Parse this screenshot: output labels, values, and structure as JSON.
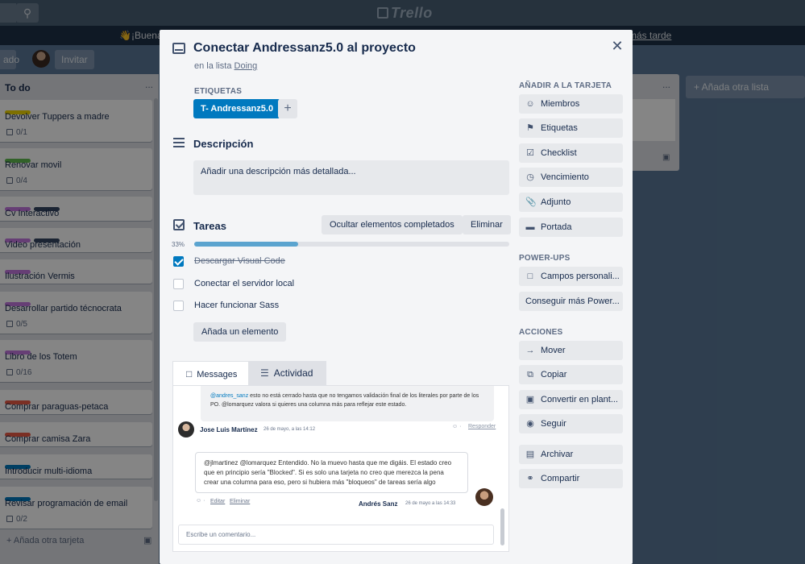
{
  "app": {
    "logo_text": "Trello"
  },
  "banner": {
    "greeting": "👋¡Buenas",
    "later_link": "más tarde"
  },
  "boardbar": {
    "left_btn": "ado",
    "invite_label": "Invitar"
  },
  "todo_list": {
    "title": "To do",
    "more": "...",
    "add_card": "+ Añada otra tarjeta",
    "cards": [
      {
        "title": "Devolver Tuppers a madre",
        "badge": "0/1",
        "labels": [
          "#f2d600"
        ]
      },
      {
        "title": "Renovar movil",
        "badge": "0/4",
        "labels": [
          "#61bd4f"
        ]
      },
      {
        "title": "Cv Interactivo",
        "badge": "",
        "labels": [
          "#c377e0",
          "#344563"
        ]
      },
      {
        "title": "Video presentación",
        "badge": "",
        "labels": [
          "#c377e0",
          "#344563"
        ]
      },
      {
        "title": "Ilustración Vermis",
        "badge": "",
        "labels": [
          "#c377e0"
        ]
      },
      {
        "title": "Desarrollar partido técnocrata",
        "badge": "0/5",
        "labels": [
          "#c377e0"
        ]
      },
      {
        "title": "Libro de los Totem",
        "badge": "0/16",
        "labels": [
          "#c377e0"
        ]
      },
      {
        "title": "Comprar paraguas-petaca",
        "badge": "",
        "labels": [
          "#eb5a46"
        ]
      },
      {
        "title": "Comprar camisa Zara",
        "badge": "",
        "labels": [
          "#eb5a46"
        ]
      },
      {
        "title": "Introducir multi-idioma",
        "badge": "",
        "labels": [
          "#0079bf"
        ]
      },
      {
        "title": "Revisar programación de email",
        "badge": "0/2",
        "labels": [
          "#0079bf"
        ]
      }
    ]
  },
  "doing_list": {
    "more": "..."
  },
  "add_list": "+ Añada otra lista",
  "modal": {
    "title": "Conectar Andressanz5.0 al proyecto",
    "in_list_prefix": "en la lista ",
    "in_list_name": "Doing",
    "labels_heading": "ETIQUETAS",
    "label_chip": "T- Andressanz5.0",
    "label_chip_color": "#0079bf",
    "description_heading": "Descripción",
    "description_placeholder": "Añadir una descripción más detallada...",
    "checklist": {
      "title": "Tareas",
      "hide_label": "Ocultar elementos completados",
      "delete_label": "Eliminar",
      "progress_text": "33%",
      "progress": 0.33,
      "items": [
        {
          "text": "Descargar Visual Code",
          "done": true
        },
        {
          "text": "Conectar el servidor local",
          "done": false
        },
        {
          "text": "Hacer funcionar Sass",
          "done": false
        }
      ],
      "add_item": "Añada un elemento"
    },
    "comments": {
      "tab_messages": "Messages",
      "tab_activity": "Actividad",
      "prev_mention": "@andres_sanz",
      "prev_text": " esto no está cerrado hasta que no tengamos validación final de los literales por parte de los PO. @lomarquez valora si quieres una columna más para reflejar este estado.",
      "prev_reply": "Responder",
      "prev_author": "Jose Luis Martínez",
      "prev_date": "26 de mayo, a las 14:12",
      "main_text": "@jlmartinez @lomarquez Entendido. No la muevo hasta que me digáis. El estado creo que en principio sería \"Blocked\". Si es solo una tarjeta no creo que merezca la pena crear una columna para eso, pero si hubiera más \"bloqueos\" de tareas sería algo",
      "edit": "Editar",
      "delete": "Eliminar",
      "author": "Andrés Sanz",
      "date": "26 de mayo a las 14:33",
      "input_placeholder": "Escribe un comentario..."
    },
    "sidebar": {
      "add_heading": "AÑADIR A LA TARJETA",
      "add_items": [
        {
          "label": "Miembros",
          "icon": "person-icon"
        },
        {
          "label": "Etiquetas",
          "icon": "tag-icon"
        },
        {
          "label": "Checklist",
          "icon": "checklist-icon"
        },
        {
          "label": "Vencimiento",
          "icon": "clock-icon"
        },
        {
          "label": "Adjunto",
          "icon": "paperclip-icon"
        },
        {
          "label": "Portada",
          "icon": "cover-icon"
        }
      ],
      "powerups_heading": "POWER-UPS",
      "powerups_items": [
        {
          "label": "Campos personali...",
          "icon": "folder-icon"
        },
        {
          "label": "Conseguir más Power...",
          "icon": ""
        }
      ],
      "actions_heading": "ACCIONES",
      "action_items": [
        {
          "label": "Mover",
          "icon": "arrow-right-icon"
        },
        {
          "label": "Copiar",
          "icon": "copy-icon"
        },
        {
          "label": "Convertir en plant...",
          "icon": "template-icon"
        },
        {
          "label": "Seguir",
          "icon": "eye-icon"
        },
        {
          "label": "Archivar",
          "icon": "archive-icon"
        },
        {
          "label": "Compartir",
          "icon": "share-icon"
        }
      ]
    }
  }
}
